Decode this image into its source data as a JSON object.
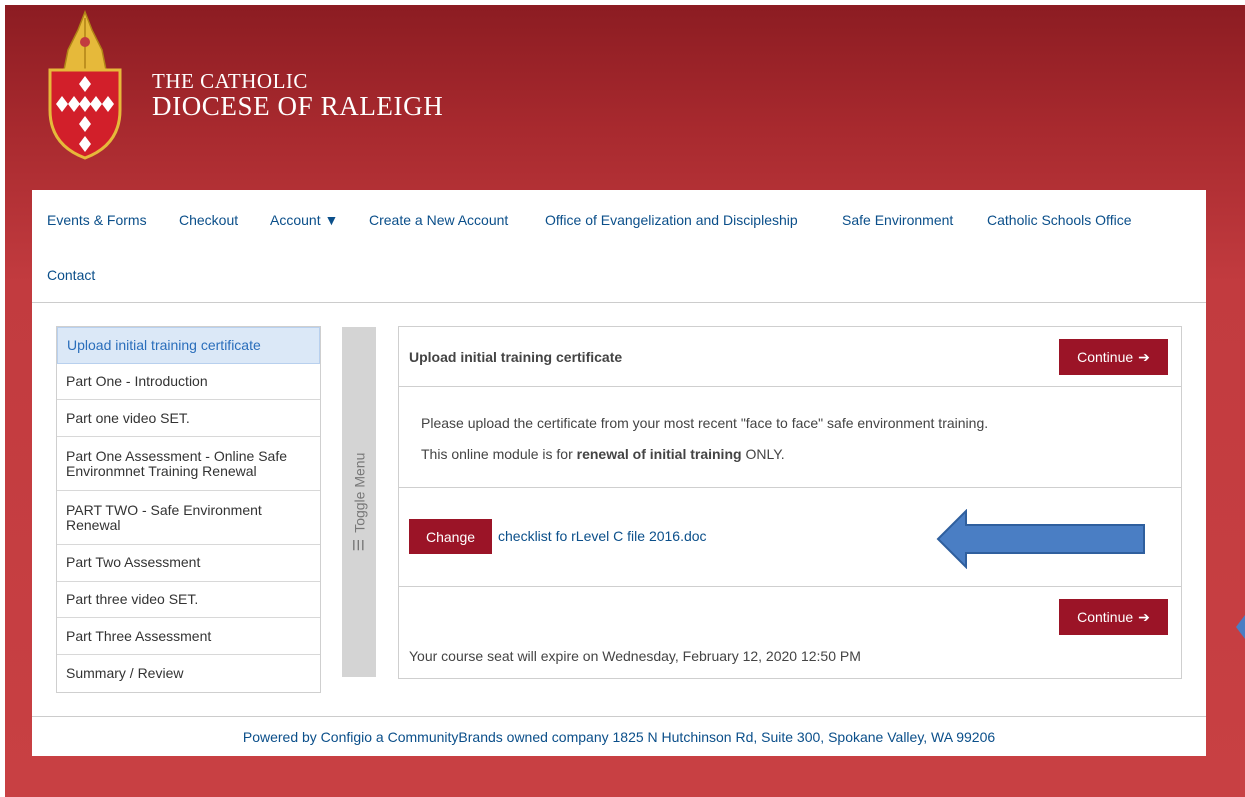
{
  "brand": {
    "line1": "THE CATHOLIC",
    "line2": "DIOCESE OF RALEIGH"
  },
  "nav": {
    "events": "Events & Forms",
    "checkout": "Checkout",
    "account": "Account",
    "create": "Create a New Account",
    "evangelization": "Office of Evangelization and Discipleship",
    "safe": "Safe Environment",
    "schools": "Catholic Schools Office",
    "contact": "Contact"
  },
  "sidebar": {
    "items": [
      "Upload initial training certificate",
      "Part One - Introduction",
      "Part one video SET.",
      "Part One Assessment - Online Safe Environmnet Training Renewal",
      "PART TWO - Safe Environment Renewal",
      "Part Two Assessment",
      "Part three video SET.",
      "Part Three Assessment",
      "Summary / Review"
    ]
  },
  "toggle": {
    "label": "Toggle Menu"
  },
  "main": {
    "title": "Upload initial training certificate",
    "continue_label": "Continue",
    "instruction": "Please upload the certificate from your most recent \"face to face\" safe environment training.",
    "note_prefix": "This online module is for ",
    "note_bold": "renewal of initial training",
    "note_suffix": " ONLY.",
    "change_label": "Change",
    "file_name": "checklist fo rLevel C file 2016.doc",
    "expiry": "Your course seat will expire on Wednesday, February 12, 2020 12:50 PM"
  },
  "footer": {
    "text": "Powered by Configio a CommunityBrands owned company 1825 N Hutchinson Rd, Suite 300, Spokane Valley, WA 99206"
  },
  "colors": {
    "accent_red": "#9b1427",
    "link_blue": "#0b4f8a",
    "arrow_blue": "#4a7ec4"
  }
}
